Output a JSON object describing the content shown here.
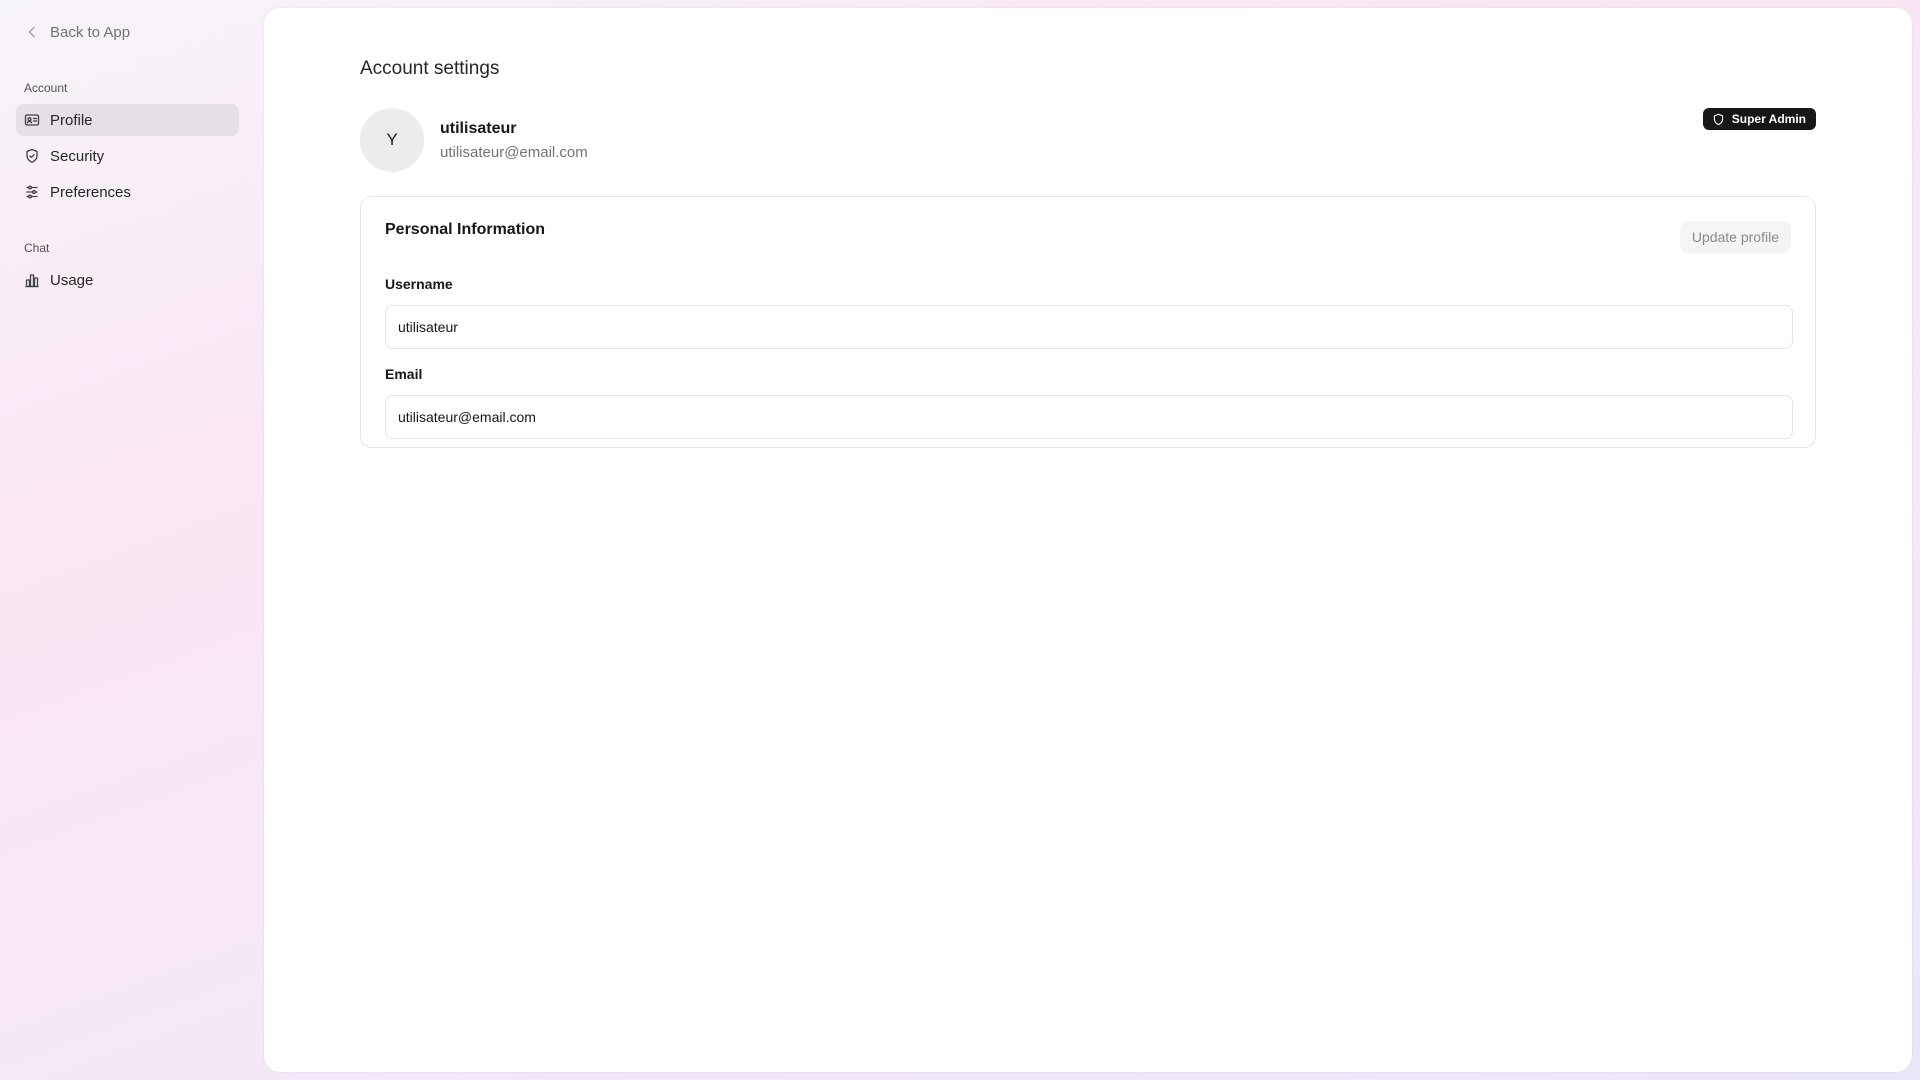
{
  "sidebar": {
    "back_label": "Back to App",
    "sections": [
      {
        "label": "Account",
        "items": [
          {
            "label": "Profile",
            "icon": "id-card-icon",
            "active": true
          },
          {
            "label": "Security",
            "icon": "shield-icon"
          },
          {
            "label": "Preferences",
            "icon": "sliders-icon"
          }
        ]
      },
      {
        "label": "Chat",
        "items": [
          {
            "label": "Usage",
            "icon": "bar-chart-icon"
          }
        ]
      }
    ]
  },
  "main": {
    "title": "Account settings",
    "user": {
      "initial": "Y",
      "name": "utilisateur",
      "email": "utilisateur@email.com",
      "role_badge": "Super Admin"
    },
    "personal_info": {
      "title": "Personal Information",
      "update_button": "Update profile",
      "username_label": "Username",
      "username_value": "utilisateur",
      "email_label": "Email",
      "email_value": "utilisateur@email.com"
    }
  },
  "colors": {
    "badge_bg": "#171717",
    "active_nav_bg": "#e6dfe5",
    "muted_text": "#737373"
  }
}
